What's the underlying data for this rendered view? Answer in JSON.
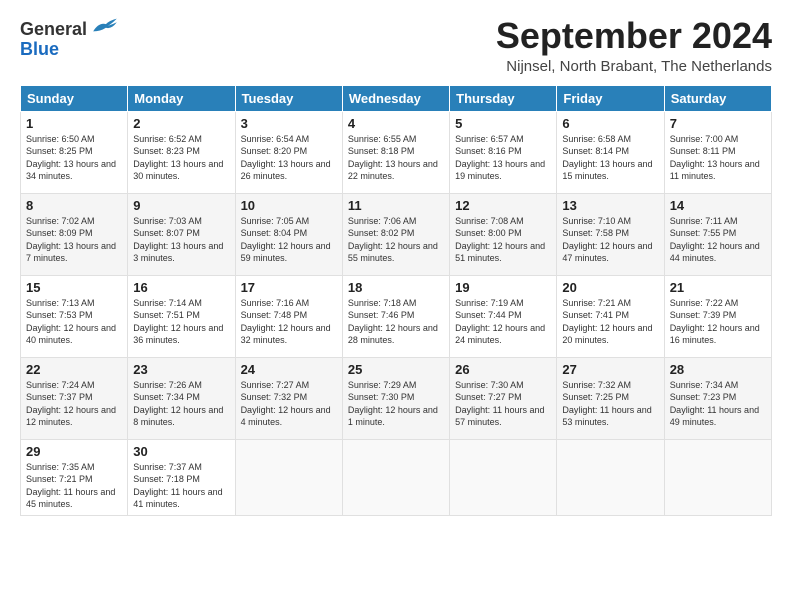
{
  "header": {
    "logo_general": "General",
    "logo_blue": "Blue",
    "month_title": "September 2024",
    "location": "Nijnsel, North Brabant, The Netherlands"
  },
  "weekdays": [
    "Sunday",
    "Monday",
    "Tuesday",
    "Wednesday",
    "Thursday",
    "Friday",
    "Saturday"
  ],
  "weeks": [
    [
      {
        "day": "1",
        "rise": "6:50 AM",
        "set": "8:25 PM",
        "daylight": "13 hours and 34 minutes."
      },
      {
        "day": "2",
        "rise": "6:52 AM",
        "set": "8:23 PM",
        "daylight": "13 hours and 30 minutes."
      },
      {
        "day": "3",
        "rise": "6:54 AM",
        "set": "8:20 PM",
        "daylight": "13 hours and 26 minutes."
      },
      {
        "day": "4",
        "rise": "6:55 AM",
        "set": "8:18 PM",
        "daylight": "13 hours and 22 minutes."
      },
      {
        "day": "5",
        "rise": "6:57 AM",
        "set": "8:16 PM",
        "daylight": "13 hours and 19 minutes."
      },
      {
        "day": "6",
        "rise": "6:58 AM",
        "set": "8:14 PM",
        "daylight": "13 hours and 15 minutes."
      },
      {
        "day": "7",
        "rise": "7:00 AM",
        "set": "8:11 PM",
        "daylight": "13 hours and 11 minutes."
      }
    ],
    [
      {
        "day": "8",
        "rise": "7:02 AM",
        "set": "8:09 PM",
        "daylight": "13 hours and 7 minutes."
      },
      {
        "day": "9",
        "rise": "7:03 AM",
        "set": "8:07 PM",
        "daylight": "13 hours and 3 minutes."
      },
      {
        "day": "10",
        "rise": "7:05 AM",
        "set": "8:04 PM",
        "daylight": "12 hours and 59 minutes."
      },
      {
        "day": "11",
        "rise": "7:06 AM",
        "set": "8:02 PM",
        "daylight": "12 hours and 55 minutes."
      },
      {
        "day": "12",
        "rise": "7:08 AM",
        "set": "8:00 PM",
        "daylight": "12 hours and 51 minutes."
      },
      {
        "day": "13",
        "rise": "7:10 AM",
        "set": "7:58 PM",
        "daylight": "12 hours and 47 minutes."
      },
      {
        "day": "14",
        "rise": "7:11 AM",
        "set": "7:55 PM",
        "daylight": "12 hours and 44 minutes."
      }
    ],
    [
      {
        "day": "15",
        "rise": "7:13 AM",
        "set": "7:53 PM",
        "daylight": "12 hours and 40 minutes."
      },
      {
        "day": "16",
        "rise": "7:14 AM",
        "set": "7:51 PM",
        "daylight": "12 hours and 36 minutes."
      },
      {
        "day": "17",
        "rise": "7:16 AM",
        "set": "7:48 PM",
        "daylight": "12 hours and 32 minutes."
      },
      {
        "day": "18",
        "rise": "7:18 AM",
        "set": "7:46 PM",
        "daylight": "12 hours and 28 minutes."
      },
      {
        "day": "19",
        "rise": "7:19 AM",
        "set": "7:44 PM",
        "daylight": "12 hours and 24 minutes."
      },
      {
        "day": "20",
        "rise": "7:21 AM",
        "set": "7:41 PM",
        "daylight": "12 hours and 20 minutes."
      },
      {
        "day": "21",
        "rise": "7:22 AM",
        "set": "7:39 PM",
        "daylight": "12 hours and 16 minutes."
      }
    ],
    [
      {
        "day": "22",
        "rise": "7:24 AM",
        "set": "7:37 PM",
        "daylight": "12 hours and 12 minutes."
      },
      {
        "day": "23",
        "rise": "7:26 AM",
        "set": "7:34 PM",
        "daylight": "12 hours and 8 minutes."
      },
      {
        "day": "24",
        "rise": "7:27 AM",
        "set": "7:32 PM",
        "daylight": "12 hours and 4 minutes."
      },
      {
        "day": "25",
        "rise": "7:29 AM",
        "set": "7:30 PM",
        "daylight": "12 hours and 1 minute."
      },
      {
        "day": "26",
        "rise": "7:30 AM",
        "set": "7:27 PM",
        "daylight": "11 hours and 57 minutes."
      },
      {
        "day": "27",
        "rise": "7:32 AM",
        "set": "7:25 PM",
        "daylight": "11 hours and 53 minutes."
      },
      {
        "day": "28",
        "rise": "7:34 AM",
        "set": "7:23 PM",
        "daylight": "11 hours and 49 minutes."
      }
    ],
    [
      {
        "day": "29",
        "rise": "7:35 AM",
        "set": "7:21 PM",
        "daylight": "11 hours and 45 minutes."
      },
      {
        "day": "30",
        "rise": "7:37 AM",
        "set": "7:18 PM",
        "daylight": "11 hours and 41 minutes."
      },
      null,
      null,
      null,
      null,
      null
    ]
  ],
  "labels": {
    "sunrise": "Sunrise:",
    "sunset": "Sunset:",
    "daylight": "Daylight:"
  }
}
